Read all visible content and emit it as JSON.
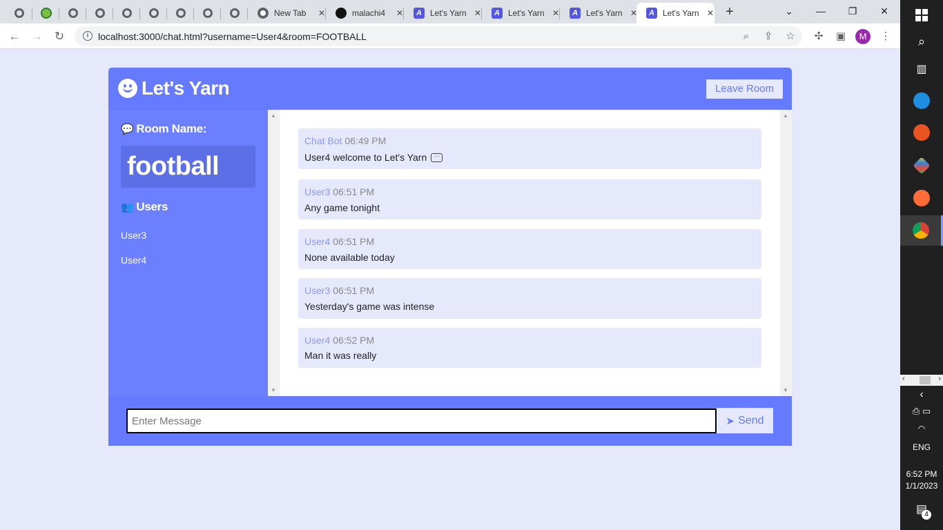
{
  "browser": {
    "tabs": [
      {
        "label": "",
        "icon": "globe-icon"
      },
      {
        "label": "",
        "icon": "green-badge-icon"
      },
      {
        "label": "",
        "icon": "globe-icon"
      },
      {
        "label": "",
        "icon": "globe-icon"
      },
      {
        "label": "",
        "icon": "globe-icon"
      },
      {
        "label": "",
        "icon": "globe-icon"
      },
      {
        "label": "",
        "icon": "globe-icon"
      },
      {
        "label": "",
        "icon": "globe-icon"
      },
      {
        "label": "",
        "icon": "globe-icon"
      },
      {
        "label": "New Tab",
        "icon": "chrome-icon"
      },
      {
        "label": "malachi4",
        "icon": "github-icon"
      },
      {
        "label": "Let's Yarn",
        "icon": "yarn-icon"
      },
      {
        "label": "Let's Yarn",
        "icon": "yarn-icon"
      },
      {
        "label": "Let's Yarn",
        "icon": "yarn-icon"
      },
      {
        "label": "Let's Yarn",
        "icon": "yarn-icon",
        "active": true
      }
    ],
    "url": "localhost:3000/chat.html?username=User4&room=FOOTBALL",
    "profile_initial": "M"
  },
  "app": {
    "title": "Let's Yarn",
    "leave_label": "Leave Room",
    "room_heading": "Room Name:",
    "room_name": "football",
    "users_heading": "Users",
    "users": [
      "User3",
      "User4"
    ],
    "messages": [
      {
        "user": "Chat Bot",
        "time": "06:49 PM",
        "text": "User4 welcome to Let's Yarn"
      },
      {
        "user": "User3",
        "time": "06:51 PM",
        "text": "Any game tonight"
      },
      {
        "user": "User4",
        "time": "06:51 PM",
        "text": "None available today"
      },
      {
        "user": "User3",
        "time": "06:51 PM",
        "text": "Yesterday's game was intense"
      },
      {
        "user": "User4",
        "time": "06:52 PM",
        "text": "Man it was really"
      }
    ],
    "input_placeholder": "Enter Message",
    "input_value": "",
    "send_label": "Send"
  },
  "taskbar": {
    "language": "ENG",
    "time": "6:52 PM",
    "date": "1/1/2023",
    "notification_count": "4"
  },
  "colors": {
    "accent": "#667aff",
    "sidebar": "#6c80ff",
    "room_box": "#5c6fe6",
    "light_bg": "#e6e8fc",
    "username": "#8d99ff"
  }
}
